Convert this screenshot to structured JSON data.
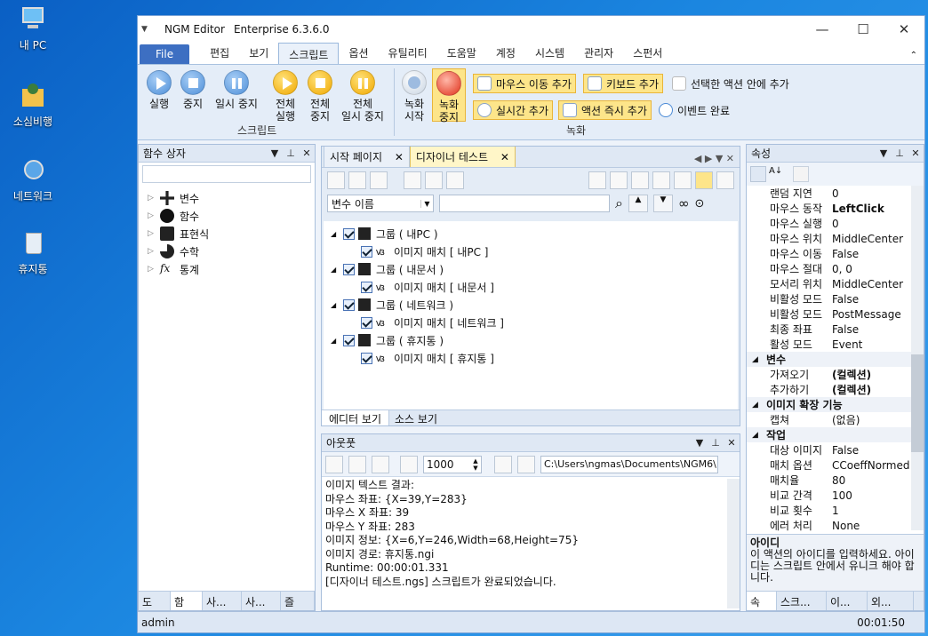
{
  "desktop": {
    "icons": [
      {
        "label": "내 PC"
      },
      {
        "label": "소심비행"
      },
      {
        "label": "네트워크"
      },
      {
        "label": "휴지통"
      }
    ]
  },
  "window": {
    "app": "NGM Editor",
    "edition": "Enterprise 6.3.6.0",
    "controls": {
      "min": "—",
      "max": "☐",
      "close": "✕"
    }
  },
  "menu": {
    "file": "File",
    "items": [
      "편집",
      "보기",
      "스크립트",
      "옵션",
      "유틸리티",
      "도움말",
      "계정",
      "시스템",
      "관리자",
      "스펀서"
    ],
    "active_index": 2
  },
  "ribbon": {
    "run": "실행",
    "stop": "중지",
    "pause": "일시 중지",
    "run_all_1": "전체",
    "run_all_2": "실행",
    "stop_all_1": "전체",
    "stop_all_2": "중지",
    "pause_all_1": "전체",
    "pause_all_2": "일시 중지",
    "script_group": "스크립트",
    "rec_start_1": "녹화",
    "rec_start_2": "시작",
    "rec_stop_1": "녹화",
    "rec_stop_2": "중지",
    "add_mouse": "마우스 이동 추가",
    "add_keyboard": "키보드 추가",
    "add_in_selected": "선택한 액션 안에 추가",
    "add_realtime": "실시간 추가",
    "add_action_now": "액션 즉시 추가",
    "event_complete": "이벤트 완료",
    "record_group": "녹화"
  },
  "func_panel": {
    "title": "함수 상자",
    "items": [
      "변수",
      "함수",
      "표현식",
      "수학",
      "통계"
    ],
    "tabs": [
      "도",
      "함",
      "사...",
      "사...",
      "즐"
    ]
  },
  "editor": {
    "tabs": [
      "시작 페이지",
      "디자이너 테스트"
    ],
    "var_select": "변수 이름",
    "tree": [
      {
        "group": "그룹 ( 내PC )",
        "child": "이미지 매치 [ 내PC ]"
      },
      {
        "group": "그룹 ( 내문서 )",
        "child": "이미지 매치 [ 내문서 ]"
      },
      {
        "group": "그룹 ( 네트워크 )",
        "child": "이미지 매치 [ 네트워크 ]"
      },
      {
        "group": "그룹 ( 휴지통 )",
        "child": "이미지 매치 [ 휴지통 ]"
      }
    ],
    "bottom_tabs": [
      "에디터 보기",
      "소스 보기"
    ]
  },
  "output": {
    "title": "아웃풋",
    "count": "1000",
    "path": "C:\\Users\\ngmas\\Documents\\NGM6\\",
    "lines": [
      "이미지 텍스트 결과:",
      "마우스 좌표: {X=39,Y=283}",
      "마우스 X 좌표: 39",
      "마우스 Y 좌표: 283",
      "이미지 정보: {X=6,Y=246,Width=68,Height=75}",
      "이미지 경로: 휴지통.ngi",
      "Runtime: 00:00:01.331",
      "[디자이너 테스트.ngs] 스크립트가 완료되었습니다."
    ]
  },
  "props": {
    "title": "속성",
    "rows": [
      {
        "k": "랜덤 지연",
        "v": "0"
      },
      {
        "k": "마우스 동작",
        "v": "LeftClick",
        "b": true
      },
      {
        "k": "마우스 실행",
        "v": "0"
      },
      {
        "k": "마우스 위치",
        "v": "MiddleCenter"
      },
      {
        "k": "마우스 이동",
        "v": "False"
      },
      {
        "k": "마우스 절대",
        "v": "0, 0"
      },
      {
        "k": "모서리 위치",
        "v": "MiddleCenter"
      },
      {
        "k": "비활성 모드",
        "v": "False"
      },
      {
        "k": "비활성 모드",
        "v": "PostMessage"
      },
      {
        "k": "최종 좌표",
        "v": "False"
      },
      {
        "k": "활성 모드",
        "v": "Event"
      }
    ],
    "cat_var": "변수",
    "var_rows": [
      {
        "k": "가져오기",
        "v": "(컬렉션)"
      },
      {
        "k": "추가하기",
        "v": "(컬렉션)"
      }
    ],
    "cat_img": "이미지 확장 기능",
    "img_rows": [
      {
        "k": "캡쳐",
        "v": "(없음)"
      }
    ],
    "cat_job": "작업",
    "job_rows": [
      {
        "k": "대상 이미지",
        "v": "False"
      },
      {
        "k": "매치 옵션",
        "v": "CCoeffNormed"
      },
      {
        "k": "매치율",
        "v": "80"
      },
      {
        "k": "비교 간격",
        "v": "100"
      },
      {
        "k": "비교 횟수",
        "v": "1"
      },
      {
        "k": "에러 처리",
        "v": "None"
      }
    ],
    "desc_title": "아이디",
    "desc": "이 액션의 아이디를 입력하세요. 아이디는 스크립트 안에서 유니크 해야 합니다.",
    "tabs": [
      "속",
      "스크...",
      "이...",
      "외..."
    ]
  },
  "status": {
    "user": "admin",
    "time": "00:01:50"
  }
}
